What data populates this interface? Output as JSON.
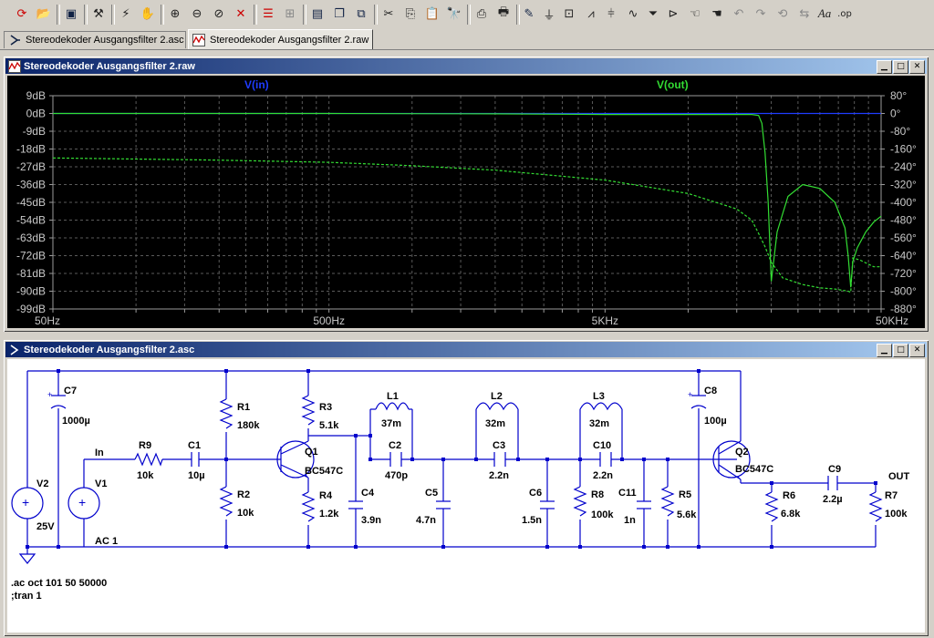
{
  "toolbar": {
    "buttons": [
      "run-icon",
      "open-icon",
      "save-icon",
      "control-panel-icon",
      "run-simulation-icon",
      "halt-icon",
      "zoom-in-icon",
      "zoom-out-icon",
      "zoom-area-icon",
      "zoom-cancel-icon",
      "autoscale-icon",
      "tile-icon",
      "cascade-icon",
      "arrange-icon",
      "cut-icon",
      "copy-icon",
      "paste-icon",
      "find-icon",
      "print-preview-icon",
      "print-icon",
      "draw-wire-icon",
      "ground-icon",
      "label-net-icon",
      "resistor-icon",
      "capacitor-icon",
      "inductor-icon",
      "diode-icon",
      "component-icon",
      "move-icon",
      "drag-icon",
      "undo-icon",
      "redo-icon",
      "rotate-icon",
      "mirror-icon",
      "text-icon",
      "spice-directive-icon"
    ]
  },
  "tabs": [
    {
      "label": "Stereodekoder Ausgangsfilter 2.asc"
    },
    {
      "label": "Stereodekoder Ausgangsfilter 2.raw"
    }
  ],
  "waveform_window": {
    "title": "Stereodekoder Ausgangsfilter 2.raw",
    "traces": [
      {
        "label": "V(in)",
        "color": "#1f3cff"
      },
      {
        "label": "V(out)",
        "color": "#33dd33"
      }
    ],
    "left_axis": [
      "9dB",
      "0dB",
      "-9dB",
      "-18dB",
      "-27dB",
      "-36dB",
      "-45dB",
      "-54dB",
      "-63dB",
      "-72dB",
      "-81dB",
      "-90dB",
      "-99dB"
    ],
    "right_axis": [
      "80°",
      "0°",
      "-80°",
      "-160°",
      "-240°",
      "-320°",
      "-400°",
      "-480°",
      "-560°",
      "-640°",
      "-720°",
      "-800°",
      "-880°"
    ],
    "x_axis": [
      "50Hz",
      "500Hz",
      "5KHz",
      "50KHz"
    ]
  },
  "chart_data": {
    "type": "line",
    "x_scale": "log",
    "xlim": [
      50,
      50000
    ],
    "ylim_left": [
      -99,
      9
    ],
    "ylim_right": [
      -880,
      80
    ],
    "series": [
      {
        "name": "V(in)",
        "axis": "left",
        "unit": "dB",
        "x": [
          50,
          50000
        ],
        "values": [
          0,
          0
        ]
      },
      {
        "name": "V(out)",
        "axis": "left",
        "unit": "dB",
        "x": [
          50,
          500,
          2000,
          5000,
          10000,
          15000,
          17000,
          18000,
          18500,
          19000,
          19500,
          20000,
          21000,
          23000,
          26000,
          30000,
          34000,
          37000,
          38000,
          38800,
          39500,
          41000,
          44000,
          47000,
          50000
        ],
        "values": [
          0,
          0,
          -0.2,
          -0.5,
          -0.5,
          -0.5,
          -0.5,
          -1,
          -5,
          -20,
          -45,
          -85,
          -60,
          -42,
          -36,
          -38,
          -45,
          -58,
          -72,
          -88,
          -75,
          -68,
          -60,
          -55,
          -52
        ]
      },
      {
        "name": "V(out)",
        "axis": "right",
        "unit": "°",
        "x": [
          50,
          200,
          500,
          1000,
          2000,
          5000,
          10000,
          15000,
          17000,
          18000,
          19000,
          20000,
          22000,
          26000,
          30000,
          34000,
          38000,
          38800,
          39500,
          42000,
          47000,
          50000
        ],
        "values": [
          -200,
          -210,
          -220,
          -235,
          -255,
          -300,
          -360,
          -430,
          -480,
          -540,
          -600,
          -670,
          -740,
          -770,
          -785,
          -790,
          -800,
          -805,
          -650,
          -660,
          -690,
          -690
        ]
      }
    ]
  },
  "schematic_window": {
    "title": "Stereodekoder Ausgangsfilter 2.asc",
    "labels": {
      "C7": "C7",
      "C7v": "1000µ",
      "V2": "V2",
      "V2v": "25V",
      "V1": "V1",
      "V1v": "AC 1",
      "In": "In",
      "R9": "R9",
      "R9v": "10k",
      "C1": "C1",
      "C1v": "10µ",
      "R1": "R1",
      "R1v": "180k",
      "R2": "R2",
      "R2v": "10k",
      "R3": "R3",
      "R3v": "5.1k",
      "Q1": "Q1",
      "Q1v": "BC547C",
      "R4": "R4",
      "R4v": "1.2k",
      "C4": "C4",
      "C4v": "3.9n",
      "L1": "L1",
      "L1v": "37m",
      "C2": "C2",
      "C2v": "470p",
      "C5": "C5",
      "C5v": "4.7n",
      "L2": "L2",
      "L2v": "32m",
      "C3": "C3",
      "C3v": "2.2n",
      "C6": "C6",
      "C6v": "1.5n",
      "L3": "L3",
      "L3v": "32m",
      "C10": "C10",
      "C10v": "2.2n",
      "R8": "R8",
      "R8v": "100k",
      "C11": "C11",
      "C11v": "1n",
      "R5": "R5",
      "R5v": "5.6k",
      "C8": "C8",
      "C8v": "100µ",
      "Q2": "Q2",
      "Q2v": "BC547C",
      "R6": "R6",
      "R6v": "6.8k",
      "C9": "C9",
      "C9v": "2.2µ",
      "R7": "R7",
      "R7v": "100k",
      "OUT": "OUT"
    },
    "directives": [
      ".ac oct 101 50 50000",
      ";tran 1"
    ]
  },
  "colors": {
    "wire": "#0000cc",
    "trace_in": "#1f3cff",
    "trace_out": "#33dd33",
    "axis_text": "#c8c8c8"
  }
}
